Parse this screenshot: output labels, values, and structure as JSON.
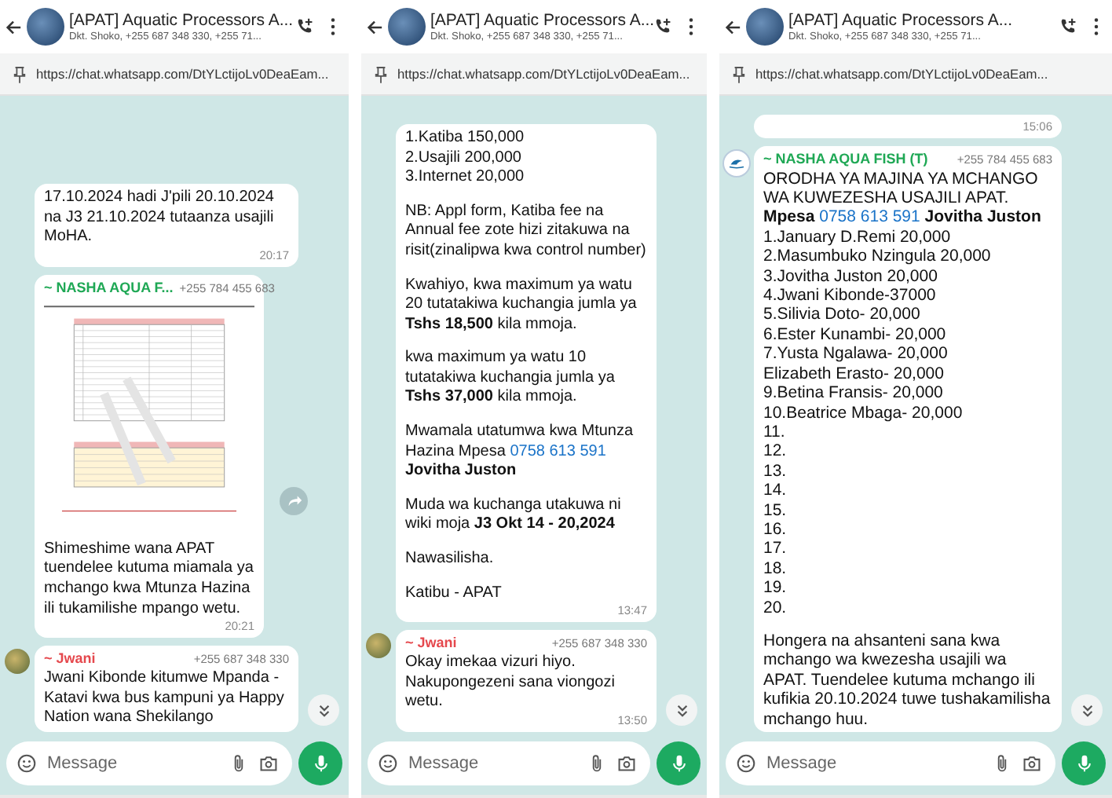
{
  "panels": [
    {
      "header": {
        "title": "[APAT] Aquatic Processors A...",
        "subtitle": "Dkt. Shoko, +255 687 348 330, +255 71..."
      },
      "pinned": {
        "url": "https://chat.whatsapp.com/DtYLctijoLv0DeaEam..."
      },
      "messages": [
        {
          "blocks": [
            [
              {
                "text": "17.10.2024 hadi J'pili 20.10.2024 na J3 21.10.2024 tutaanza usajili MoHA."
              }
            ]
          ],
          "time": "20:17"
        },
        {
          "sender": {
            "name": "~ NASHA AQUA F...",
            "color": "#1fa855",
            "phone": "+255 784 455 683"
          },
          "image": true,
          "forward": true,
          "blocks": [
            [
              {
                "text": "Shimeshime wana APAT tuendelee kutuma miamala ya mchango kwa Mtunza Hazina ili tukamilishe mpango wetu."
              }
            ]
          ],
          "time": "20:21"
        },
        {
          "avatar": {
            "kind": "photo"
          },
          "sender": {
            "name": "~ Jwani",
            "color": "#e5484d",
            "phone": "+255 687 348 330"
          },
          "blocks": [
            [
              {
                "text": "Jwani Kibonde kitumwe Mpanda - Katavi kwa bus kampuni ya Happy Nation wana Shekilango"
              }
            ]
          ]
        }
      ],
      "composer": {
        "placeholder": "Message"
      }
    },
    {
      "header": {
        "title": "[APAT] Aquatic Processors A...",
        "subtitle": "Dkt. Shoko, +255 687 348 330, +255 71..."
      },
      "pinned": {
        "url": "https://chat.whatsapp.com/DtYLctijoLv0DeaEam..."
      },
      "messages": [
        {
          "blocks": [
            [
              {
                "text": "1.Katiba 150,000"
              },
              {
                "text": "2.Usajili 200,000"
              },
              {
                "text": "3.Internet 20,000"
              }
            ],
            [
              {
                "text": "NB: Appl form, Katiba fee na Annual fee zote hizi zitakuwa na risit(zinalipwa kwa control number)"
              }
            ],
            [
              {
                "text": "Kwahiyo, kwa maximum ya watu 20 tutatakiwa kuchangia jumla ya **Tshs 18,500** kila mmoja."
              }
            ],
            [
              {
                "text": "kwa maximum ya watu 10 tutatakiwa kuchangia jumla ya **Tshs 37,000** kila mmoja."
              }
            ],
            [
              {
                "text": "Mwamala utatumwa kwa Mtunza Hazina Mpesa ",
                "link": "0758 613 591",
                "after": " **Jovitha Juston**"
              }
            ],
            [
              {
                "text": "Muda wa kuchanga utakuwa ni wiki moja **J3 Okt 14 - 20,2024**"
              }
            ],
            [
              {
                "text": "Nawasilisha."
              }
            ],
            [
              {
                "text": "Katibu - APAT"
              }
            ]
          ],
          "time": "13:47"
        },
        {
          "avatar": {
            "kind": "photo"
          },
          "sender": {
            "name": "~ Jwani",
            "color": "#e5484d",
            "phone": "+255 687 348 330"
          },
          "blocks": [
            [
              {
                "text": "Okay imekaa vizuri hiyo. Nakupongezeni sana viongozi wetu."
              }
            ]
          ],
          "time": "13:50"
        }
      ],
      "composer": {
        "placeholder": "Message"
      }
    },
    {
      "header": {
        "title": "[APAT] Aquatic Processors A...",
        "subtitle": "Dkt. Shoko, +255 687 348 330, +255 71..."
      },
      "pinned": {
        "url": "https://chat.whatsapp.com/DtYLctijoLv0DeaEam..."
      },
      "messages": [
        {
          "time": "15:06"
        },
        {
          "avatar": {
            "kind": "logo"
          },
          "sender": {
            "name": "~ NASHA AQUA FISH (T)",
            "color": "#1fa855",
            "phone": "+255 784 455 683"
          },
          "blocks": [
            [
              {
                "text": "ORODHA YA MAJINA YA MCHANGO WA KUWEZESHA USAJILI APAT."
              },
              {
                "text": "**Mpesa** ",
                "link": "0758 613 591",
                "after": " **Jovitha Juston**"
              },
              {
                "text": "1.January D.Remi 20,000"
              },
              {
                "text": "2.Masumbuko Nzingula 20,000"
              },
              {
                "text": "3.Jovitha Juston 20,000"
              },
              {
                "text": "4.Jwani Kibonde-37000"
              },
              {
                "text": "5.Silivia Doto- 20,000"
              },
              {
                "text": "6.Ester Kunambi- 20,000"
              },
              {
                "text": "7.Yusta Ngalawa- 20,000"
              },
              {
                "text": "Elizabeth Erasto- 20,000"
              },
              {
                "text": "9.Betina Fransis- 20,000"
              },
              {
                "text": "10.Beatrice Mbaga- 20,000"
              },
              {
                "text": "11."
              },
              {
                "text": "12."
              },
              {
                "text": "13."
              },
              {
                "text": "14."
              },
              {
                "text": "15."
              },
              {
                "text": "16."
              },
              {
                "text": "17."
              },
              {
                "text": "18."
              },
              {
                "text": "19."
              },
              {
                "text": "20."
              }
            ],
            [
              {
                "text": "Hongera na ahsanteni sana kwa mchango  wa kwezesha usajili wa APAT. Tuendelee kutuma mchango ili kufikia 20.10.2024 tuwe tushakamilisha mchango huu."
              }
            ]
          ]
        }
      ],
      "composer": {
        "placeholder": "Message"
      }
    }
  ]
}
